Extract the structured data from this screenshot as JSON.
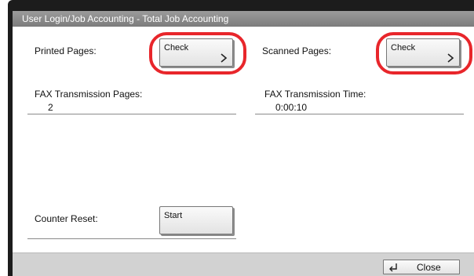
{
  "window": {
    "title": "User Login/Job Accounting - Total Job Accounting"
  },
  "printed": {
    "label": "Printed Pages:",
    "button_label": "Check"
  },
  "scanned": {
    "label": "Scanned Pages:",
    "button_label": "Check"
  },
  "fax_pages": {
    "label": "FAX Transmission Pages:",
    "value": "2"
  },
  "fax_time": {
    "label": "FAX Transmission Time:",
    "value": "0:00:10"
  },
  "counter_reset": {
    "label": "Counter Reset:",
    "button_label": "Start"
  },
  "footer": {
    "close_label": "Close"
  },
  "colors": {
    "highlight": "#e8262b",
    "titlebar": "#8a8a8a",
    "footer": "#d2d2d2"
  },
  "icons": {
    "check_chevron": "chevron-right-icon",
    "close_enter": "enter-return-icon"
  }
}
